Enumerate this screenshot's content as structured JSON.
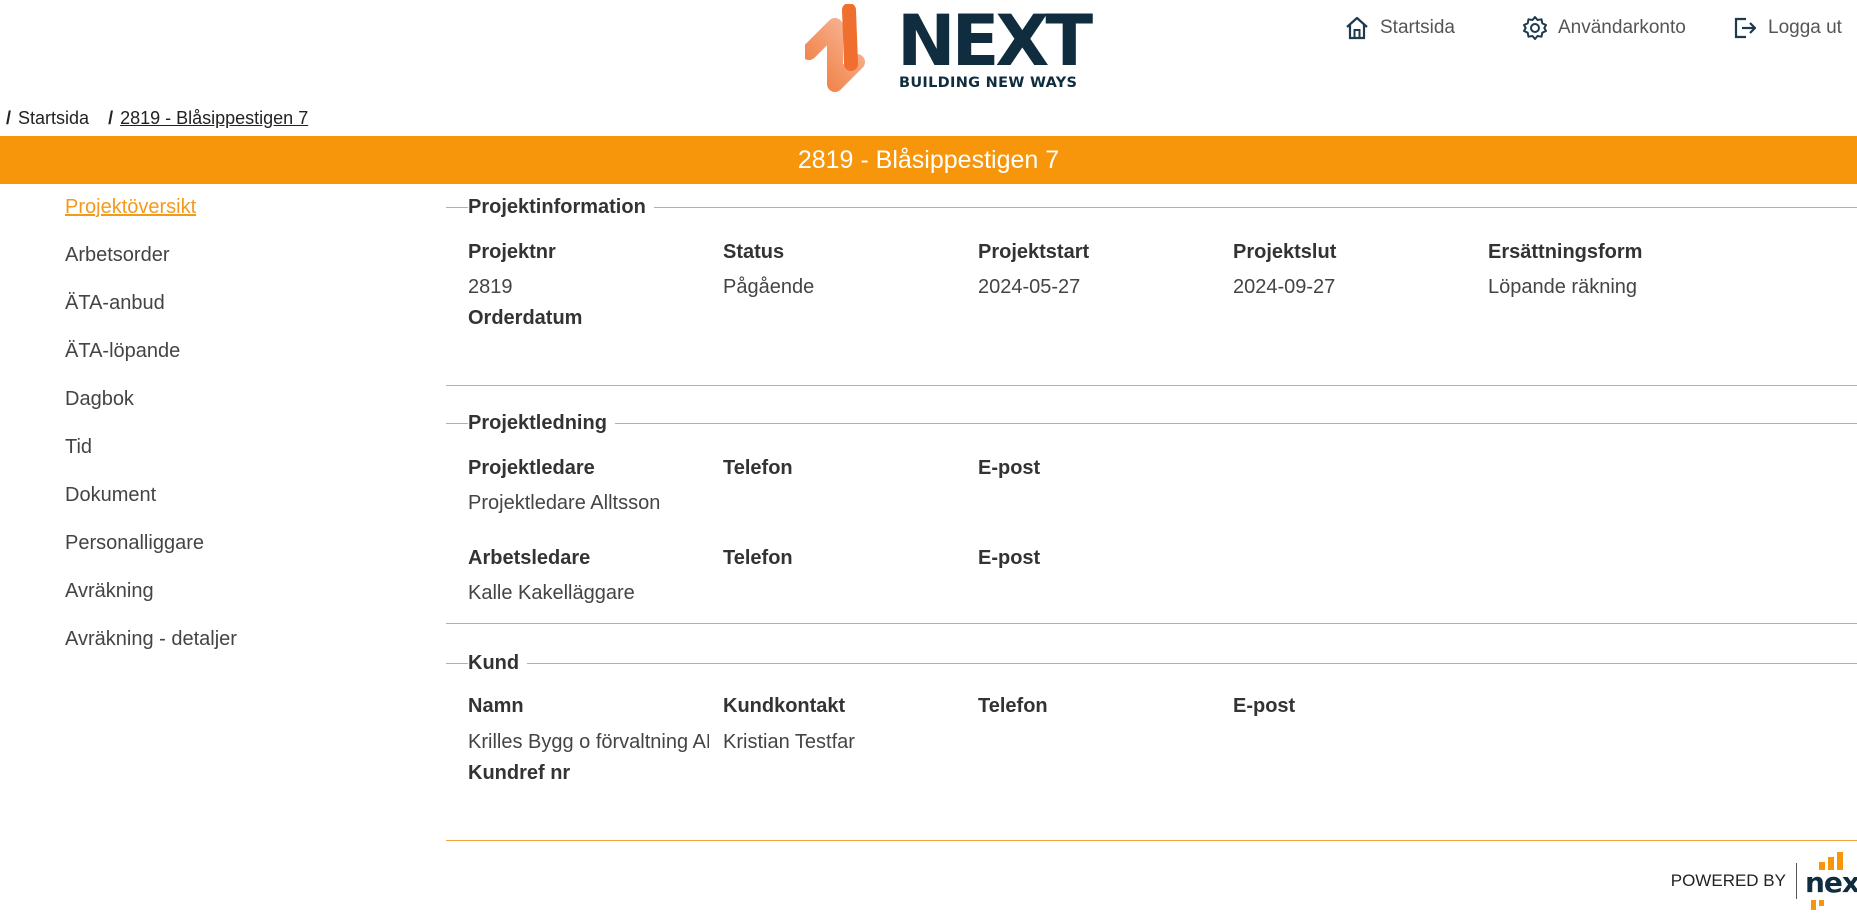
{
  "brand": {
    "logo_word": "NEXT",
    "tagline": "BUILDING NEW WAYS",
    "accent_color": "#f7960a",
    "navy_color": "#0f2d3f"
  },
  "topnav": {
    "home": {
      "label": "Startsida",
      "icon": "home-icon"
    },
    "account": {
      "label": "Användarkonto",
      "icon": "gear-icon"
    },
    "logout": {
      "label": "Logga ut",
      "icon": "logout-icon"
    }
  },
  "breadcrumb": {
    "items": [
      {
        "label": "Startsida"
      },
      {
        "label": "2819 - Blåsippestigen 7"
      }
    ]
  },
  "banner": {
    "title": "2819 - Blåsippestigen 7"
  },
  "sidebar": {
    "items": [
      {
        "label": "Projektöversikt",
        "active": true
      },
      {
        "label": "Arbetsorder"
      },
      {
        "label": "ÄTA-anbud"
      },
      {
        "label": "ÄTA-löpande"
      },
      {
        "label": "Dagbok"
      },
      {
        "label": "Tid"
      },
      {
        "label": "Dokument"
      },
      {
        "label": "Personalliggare"
      },
      {
        "label": "Avräkning"
      },
      {
        "label": "Avräkning - detaljer"
      }
    ]
  },
  "projektinformation": {
    "legend": "Projektinformation",
    "projektnr_label": "Projektnr",
    "projektnr_value": "2819",
    "status_label": "Status",
    "status_value": "Pågående",
    "projektstart_label": "Projektstart",
    "projektstart_value": "2024-05-27",
    "projektslut_label": "Projektslut",
    "projektslut_value": "2024-09-27",
    "ersattningsform_label": "Ersättningsform",
    "ersattningsform_value": "Löpande räkning",
    "orderdatum_label": "Orderdatum"
  },
  "projektledning": {
    "legend": "Projektledning",
    "projektledare_label": "Projektledare",
    "projektledare_value": "Projektledare Alltsson",
    "telefon1_label": "Telefon",
    "epost1_label": "E-post",
    "arbetsledare_label": "Arbetsledare",
    "arbetsledare_value": "Kalle Kakelläggare",
    "telefon2_label": "Telefon",
    "epost2_label": "E-post"
  },
  "kund": {
    "legend": "Kund",
    "namn_label": "Namn",
    "namn_value": "Krilles Bygg o förvaltning AB",
    "kundkontakt_label": "Kundkontakt",
    "kundkontakt_value": "Kristian Testfar",
    "telefon_label": "Telefon",
    "epost_label": "E-post",
    "kundref_label": "Kundref nr"
  },
  "footer": {
    "powered_by": "POWERED BY",
    "logo_word": "next"
  }
}
